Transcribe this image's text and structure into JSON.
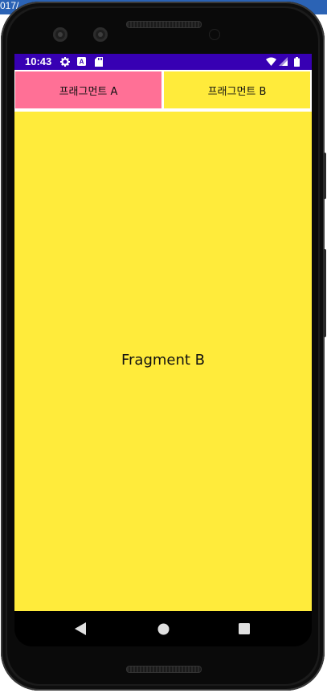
{
  "background": {
    "strip_text": "017/"
  },
  "status_bar": {
    "time": "10:43",
    "icons": [
      "gear-icon",
      "a-box-icon",
      "sd-card-icon",
      "wifi-icon",
      "signal-icon",
      "battery-icon"
    ],
    "color": "#3700b3"
  },
  "tabs": {
    "a_label": "프래그먼트 A",
    "b_label": "프래그먼트 B",
    "a_color": "#ff7096",
    "b_color": "#ffeb3b"
  },
  "content": {
    "fragment_text": "Fragment B",
    "color": "#ffeb3b"
  },
  "nav_bar": {
    "icons": [
      "back-triangle-icon",
      "home-circle-icon",
      "recents-square-icon"
    ]
  }
}
